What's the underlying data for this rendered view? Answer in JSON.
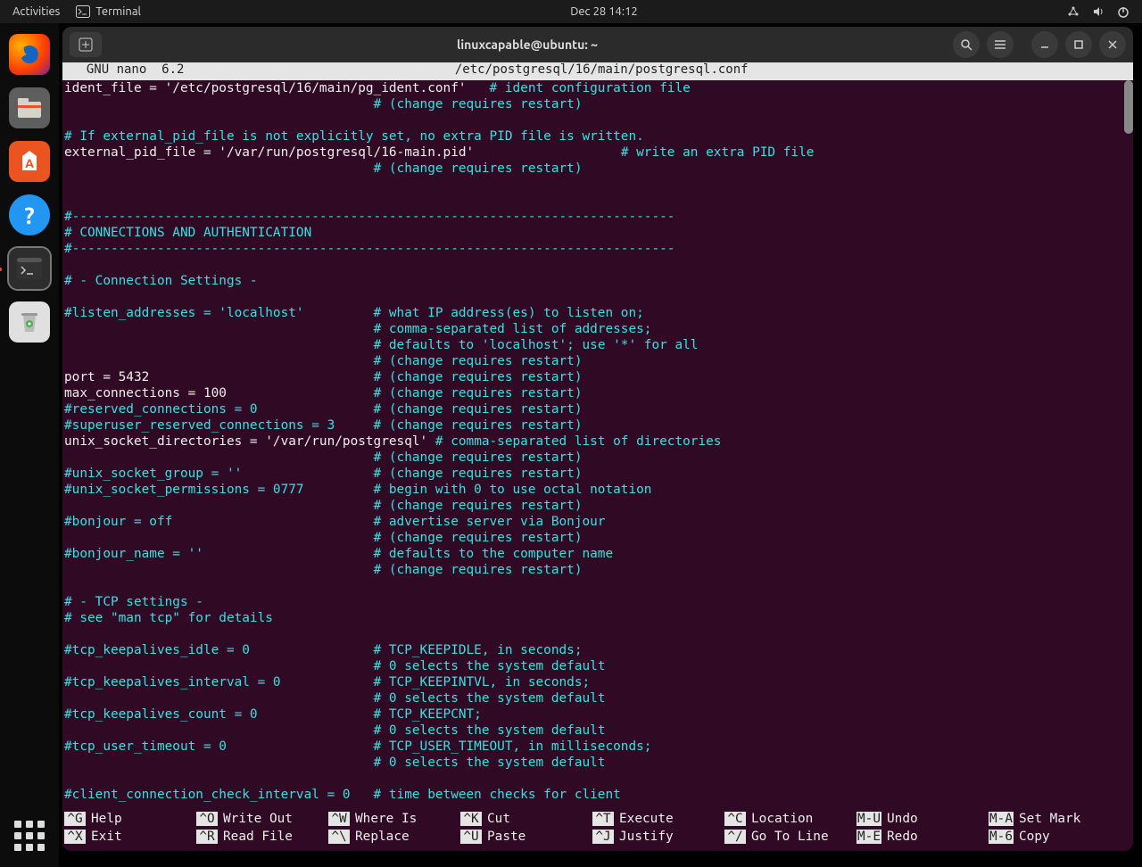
{
  "topbar": {
    "activities": "Activities",
    "app": "Terminal",
    "clock": "Dec 28  14:12"
  },
  "dock_items": [
    "firefox",
    "files",
    "software",
    "help",
    "terminal",
    "trash"
  ],
  "window_title": "linuxcapable@ubuntu: ~",
  "nano_label": "  GNU nano  6.2",
  "file_path": "/etc/postgresql/16/main/postgresql.conf",
  "lines": [
    {
      "seg": [
        {
          "t": "ident_file = '/etc/postgresql/16/main/pg_ident.conf'   ",
          "c": "w"
        },
        {
          "t": "# ident configuration file",
          "c": "c"
        }
      ]
    },
    {
      "seg": [
        {
          "t": "                                        ",
          "c": "w"
        },
        {
          "t": "# (change requires restart)",
          "c": "c"
        }
      ]
    },
    {
      "seg": [
        {
          "t": "",
          "c": "w"
        }
      ]
    },
    {
      "seg": [
        {
          "t": "# If external_pid_file is not explicitly set, no extra PID file is written.",
          "c": "c"
        }
      ]
    },
    {
      "seg": [
        {
          "t": "external_pid_file = '/var/run/postgresql/16-main.pid'                   ",
          "c": "w"
        },
        {
          "t": "# write an extra PID file",
          "c": "c"
        }
      ]
    },
    {
      "seg": [
        {
          "t": "                                        ",
          "c": "w"
        },
        {
          "t": "# (change requires restart)",
          "c": "c"
        }
      ]
    },
    {
      "seg": [
        {
          "t": "",
          "c": "w"
        }
      ]
    },
    {
      "seg": [
        {
          "t": "",
          "c": "w"
        }
      ]
    },
    {
      "seg": [
        {
          "t": "#------------------------------------------------------------------------------",
          "c": "c"
        }
      ]
    },
    {
      "seg": [
        {
          "t": "# CONNECTIONS AND AUTHENTICATION",
          "c": "c"
        }
      ]
    },
    {
      "seg": [
        {
          "t": "#------------------------------------------------------------------------------",
          "c": "c"
        }
      ]
    },
    {
      "seg": [
        {
          "t": "",
          "c": "w"
        }
      ]
    },
    {
      "seg": [
        {
          "t": "# - Connection Settings -",
          "c": "c"
        }
      ]
    },
    {
      "seg": [
        {
          "t": "",
          "c": "w"
        }
      ]
    },
    {
      "seg": [
        {
          "t": "#listen_addresses = 'localhost'         # what IP address(es) to listen on;",
          "c": "c"
        }
      ]
    },
    {
      "seg": [
        {
          "t": "                                        ",
          "c": "w"
        },
        {
          "t": "# comma-separated list of addresses;",
          "c": "c"
        }
      ]
    },
    {
      "seg": [
        {
          "t": "                                        ",
          "c": "w"
        },
        {
          "t": "# defaults to 'localhost'; use '*' for all",
          "c": "c"
        }
      ]
    },
    {
      "seg": [
        {
          "t": "                                        ",
          "c": "w"
        },
        {
          "t": "# (change requires restart)",
          "c": "c"
        }
      ]
    },
    {
      "seg": [
        {
          "t": "port = 5432                             ",
          "c": "w"
        },
        {
          "t": "# (change requires restart)",
          "c": "c"
        }
      ]
    },
    {
      "seg": [
        {
          "t": "max_connections = 100                   ",
          "c": "w"
        },
        {
          "t": "# (change requires restart)",
          "c": "c"
        }
      ]
    },
    {
      "seg": [
        {
          "t": "#reserved_connections = 0               # (change requires restart)",
          "c": "c"
        }
      ]
    },
    {
      "seg": [
        {
          "t": "#superuser_reserved_connections = 3     # (change requires restart)",
          "c": "c"
        }
      ]
    },
    {
      "seg": [
        {
          "t": "unix_socket_directories = '/var/run/postgresql' ",
          "c": "w"
        },
        {
          "t": "# comma-separated list of directories",
          "c": "c"
        }
      ]
    },
    {
      "seg": [
        {
          "t": "                                        ",
          "c": "w"
        },
        {
          "t": "# (change requires restart)",
          "c": "c"
        }
      ]
    },
    {
      "seg": [
        {
          "t": "#unix_socket_group = ''                 # (change requires restart)",
          "c": "c"
        }
      ]
    },
    {
      "seg": [
        {
          "t": "#unix_socket_permissions = 0777         # begin with 0 to use octal notation",
          "c": "c"
        }
      ]
    },
    {
      "seg": [
        {
          "t": "                                        ",
          "c": "w"
        },
        {
          "t": "# (change requires restart)",
          "c": "c"
        }
      ]
    },
    {
      "seg": [
        {
          "t": "#bonjour = off                          # advertise server via Bonjour",
          "c": "c"
        }
      ]
    },
    {
      "seg": [
        {
          "t": "                                        ",
          "c": "w"
        },
        {
          "t": "# (change requires restart)",
          "c": "c"
        }
      ]
    },
    {
      "seg": [
        {
          "t": "#bonjour_name = ''                      # defaults to the computer name",
          "c": "c"
        }
      ]
    },
    {
      "seg": [
        {
          "t": "                                        ",
          "c": "w"
        },
        {
          "t": "# (change requires restart)",
          "c": "c"
        }
      ]
    },
    {
      "seg": [
        {
          "t": "",
          "c": "w"
        }
      ]
    },
    {
      "seg": [
        {
          "t": "# - TCP settings -",
          "c": "c"
        }
      ]
    },
    {
      "seg": [
        {
          "t": "# see \"man tcp\" for details",
          "c": "c"
        }
      ]
    },
    {
      "seg": [
        {
          "t": "",
          "c": "w"
        }
      ]
    },
    {
      "seg": [
        {
          "t": "#tcp_keepalives_idle = 0                # TCP_KEEPIDLE, in seconds;",
          "c": "c"
        }
      ]
    },
    {
      "seg": [
        {
          "t": "                                        ",
          "c": "w"
        },
        {
          "t": "# 0 selects the system default",
          "c": "c"
        }
      ]
    },
    {
      "seg": [
        {
          "t": "#tcp_keepalives_interval = 0            # TCP_KEEPINTVL, in seconds;",
          "c": "c"
        }
      ]
    },
    {
      "seg": [
        {
          "t": "                                        ",
          "c": "w"
        },
        {
          "t": "# 0 selects the system default",
          "c": "c"
        }
      ]
    },
    {
      "seg": [
        {
          "t": "#tcp_keepalives_count = 0               # TCP_KEEPCNT;",
          "c": "c"
        }
      ]
    },
    {
      "seg": [
        {
          "t": "                                        ",
          "c": "w"
        },
        {
          "t": "# 0 selects the system default",
          "c": "c"
        }
      ]
    },
    {
      "seg": [
        {
          "t": "#tcp_user_timeout = 0                   # TCP_USER_TIMEOUT, in milliseconds;",
          "c": "c"
        }
      ]
    },
    {
      "seg": [
        {
          "t": "                                        ",
          "c": "w"
        },
        {
          "t": "# 0 selects the system default",
          "c": "c"
        }
      ]
    },
    {
      "seg": [
        {
          "t": "",
          "c": "w"
        }
      ]
    },
    {
      "seg": [
        {
          "t": "#client_connection_check_interval = 0   # time between checks for client",
          "c": "c"
        }
      ]
    }
  ],
  "shortcuts_row1": [
    {
      "k": "^G",
      "l": "Help"
    },
    {
      "k": "^O",
      "l": "Write Out"
    },
    {
      "k": "^W",
      "l": "Where Is"
    },
    {
      "k": "^K",
      "l": "Cut"
    },
    {
      "k": "^T",
      "l": "Execute"
    },
    {
      "k": "^C",
      "l": "Location"
    },
    {
      "k": "M-U",
      "l": "Undo"
    },
    {
      "k": "M-A",
      "l": "Set Mark"
    }
  ],
  "shortcuts_row2": [
    {
      "k": "^X",
      "l": "Exit"
    },
    {
      "k": "^R",
      "l": "Read File"
    },
    {
      "k": "^\\",
      "l": "Replace"
    },
    {
      "k": "^U",
      "l": "Paste"
    },
    {
      "k": "^J",
      "l": "Justify"
    },
    {
      "k": "^/",
      "l": "Go To Line"
    },
    {
      "k": "M-E",
      "l": "Redo"
    },
    {
      "k": "M-6",
      "l": "Copy"
    }
  ]
}
